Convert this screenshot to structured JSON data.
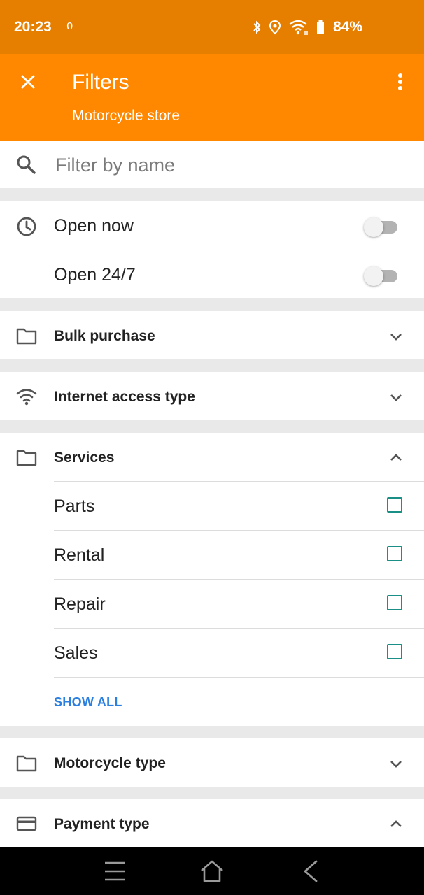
{
  "status_bar": {
    "time": "20:23",
    "hotspot_glyph": "ი",
    "battery_percent": "84%"
  },
  "app_bar": {
    "title": "Filters",
    "subtitle": "Motorcycle store"
  },
  "search": {
    "placeholder": "Filter by name",
    "value": ""
  },
  "hours": {
    "open_now": {
      "label": "Open now",
      "enabled": false
    },
    "open_24_7": {
      "label": "Open 24/7",
      "enabled": false
    }
  },
  "groups": {
    "bulk_purchase": {
      "label": "Bulk purchase",
      "expanded": false
    },
    "internet_access": {
      "label": "Internet access type",
      "expanded": false
    },
    "services": {
      "label": "Services",
      "expanded": true,
      "items": [
        {
          "label": "Parts",
          "checked": false
        },
        {
          "label": "Rental",
          "checked": false
        },
        {
          "label": "Repair",
          "checked": false
        },
        {
          "label": "Sales",
          "checked": false
        }
      ],
      "show_all_label": "SHOW ALL"
    },
    "motorcycle_type": {
      "label": "Motorcycle type",
      "expanded": false
    },
    "payment_type": {
      "label": "Payment type",
      "expanded": true
    }
  },
  "colors": {
    "status_bar": "#e67e00",
    "app_bar": "#ff8800",
    "checkbox": "#1a8f86",
    "link": "#2a7fe0"
  },
  "icons": [
    "close-icon",
    "more-vert-icon",
    "search-icon",
    "clock-icon",
    "folder-icon",
    "wifi-icon",
    "credit-card-icon",
    "chevron-down-icon",
    "chevron-up-icon"
  ]
}
